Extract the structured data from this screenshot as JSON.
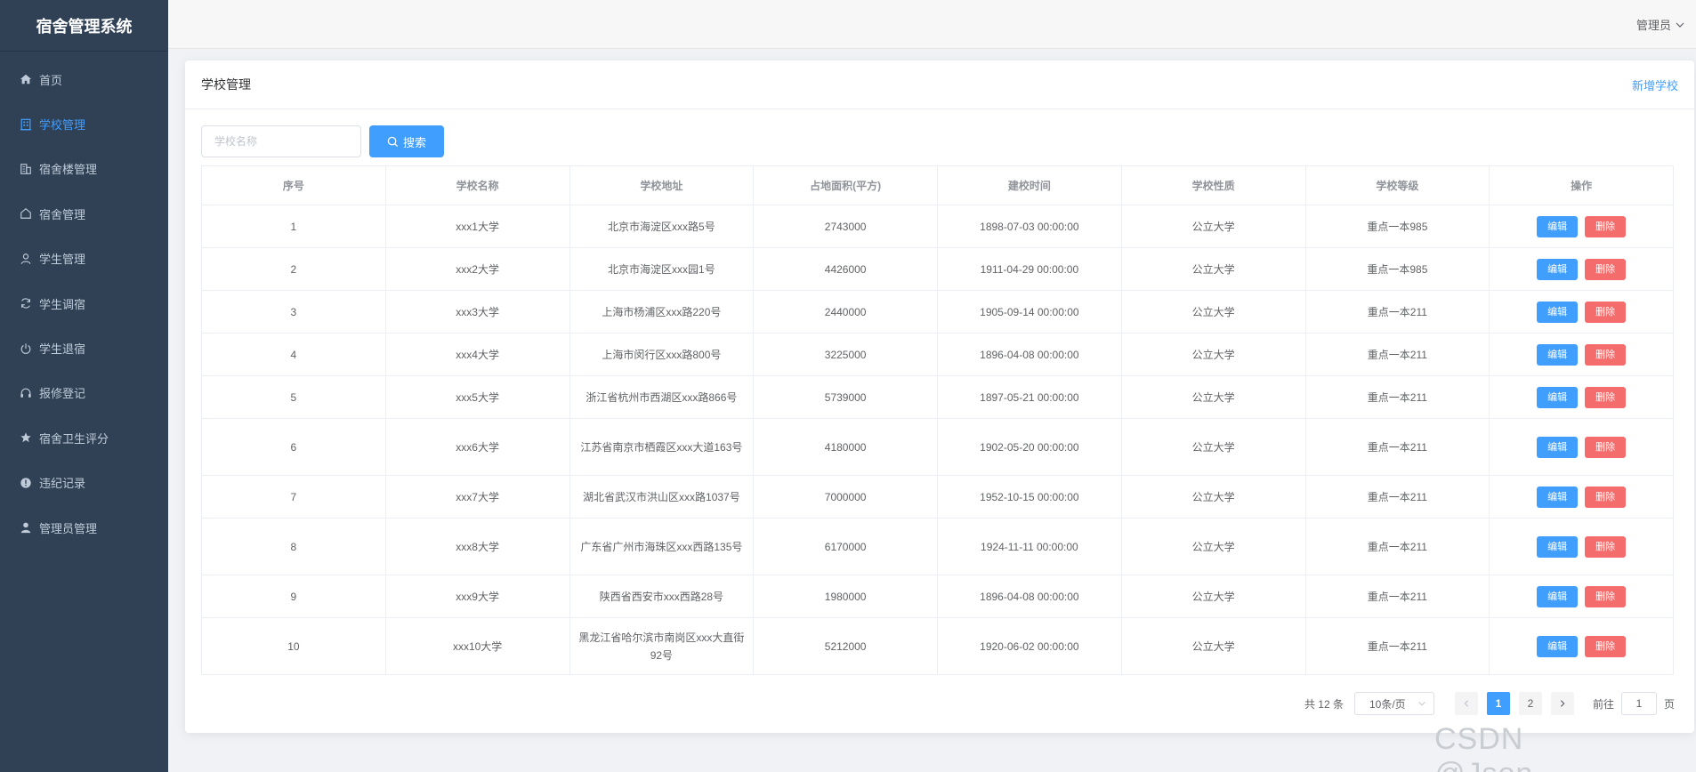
{
  "app": {
    "title": "宿舍管理系统"
  },
  "sidebar": {
    "items": [
      {
        "label": "首页",
        "icon": "home-icon",
        "active": false
      },
      {
        "label": "学校管理",
        "icon": "building-icon",
        "active": true
      },
      {
        "label": "宿舍楼管理",
        "icon": "office-icon",
        "active": false
      },
      {
        "label": "宿舍管理",
        "icon": "house-icon",
        "active": false
      },
      {
        "label": "学生管理",
        "icon": "user-icon",
        "active": false
      },
      {
        "label": "学生调宿",
        "icon": "refresh-icon",
        "active": false
      },
      {
        "label": "学生退宿",
        "icon": "power-icon",
        "active": false
      },
      {
        "label": "报修登记",
        "icon": "headset-icon",
        "active": false
      },
      {
        "label": "宿舍卫生评分",
        "icon": "star-icon",
        "active": false
      },
      {
        "label": "违纪记录",
        "icon": "warning-icon",
        "active": false
      },
      {
        "label": "管理员管理",
        "icon": "user-solid-icon",
        "active": false
      }
    ]
  },
  "header": {
    "user": "管理员"
  },
  "card": {
    "title": "学校管理",
    "add_label": "新增学校"
  },
  "search": {
    "placeholder": "学校名称",
    "value": "",
    "button": "搜索"
  },
  "table": {
    "columns": [
      "序号",
      "学校名称",
      "学校地址",
      "占地面积(平方)",
      "建校时间",
      "学校性质",
      "学校等级",
      "操作"
    ],
    "edit_label": "编辑",
    "delete_label": "删除",
    "rows": [
      {
        "no": "1",
        "name": "xxx1大学",
        "address": "北京市海淀区xxx路5号",
        "area": "2743000",
        "founded": "1898-07-03 00:00:00",
        "nature": "公立大学",
        "level": "重点一本985"
      },
      {
        "no": "2",
        "name": "xxx2大学",
        "address": "北京市海淀区xxx园1号",
        "area": "4426000",
        "founded": "1911-04-29 00:00:00",
        "nature": "公立大学",
        "level": "重点一本985"
      },
      {
        "no": "3",
        "name": "xxx3大学",
        "address": "上海市杨浦区xxx路220号",
        "area": "2440000",
        "founded": "1905-09-14 00:00:00",
        "nature": "公立大学",
        "level": "重点一本211"
      },
      {
        "no": "4",
        "name": "xxx4大学",
        "address": "上海市闵行区xxx路800号",
        "area": "3225000",
        "founded": "1896-04-08 00:00:00",
        "nature": "公立大学",
        "level": "重点一本211"
      },
      {
        "no": "5",
        "name": "xxx5大学",
        "address": "浙江省杭州市西湖区xxx路866号",
        "area": "5739000",
        "founded": "1897-05-21 00:00:00",
        "nature": "公立大学",
        "level": "重点一本211"
      },
      {
        "no": "6",
        "name": "xxx6大学",
        "address": "江苏省南京市栖霞区xxx大道163号",
        "area": "4180000",
        "founded": "1902-05-20 00:00:00",
        "nature": "公立大学",
        "level": "重点一本211"
      },
      {
        "no": "7",
        "name": "xxx7大学",
        "address": "湖北省武汉市洪山区xxx路1037号",
        "area": "7000000",
        "founded": "1952-10-15 00:00:00",
        "nature": "公立大学",
        "level": "重点一本211"
      },
      {
        "no": "8",
        "name": "xxx8大学",
        "address": "广东省广州市海珠区xxx西路135号",
        "area": "6170000",
        "founded": "1924-11-11 00:00:00",
        "nature": "公立大学",
        "level": "重点一本211"
      },
      {
        "no": "9",
        "name": "xxx9大学",
        "address": "陕西省西安市xxx西路28号",
        "area": "1980000",
        "founded": "1896-04-08 00:00:00",
        "nature": "公立大学",
        "level": "重点一本211"
      },
      {
        "no": "10",
        "name": "xxx10大学",
        "address": "黑龙江省哈尔滨市南岗区xxx大直街92号",
        "area": "5212000",
        "founded": "1920-06-02 00:00:00",
        "nature": "公立大学",
        "level": "重点一本211"
      }
    ]
  },
  "pagination": {
    "total": "共 12 条",
    "page_size": "10条/页",
    "pages": [
      "1",
      "2"
    ],
    "current": "1",
    "goto_label": "前往",
    "goto_value": "1",
    "page_suffix": "页"
  },
  "watermark": "CSDN @Json_____",
  "colors": {
    "sidebar": "#304156",
    "primary": "#409eff",
    "danger": "#f56c6c"
  }
}
